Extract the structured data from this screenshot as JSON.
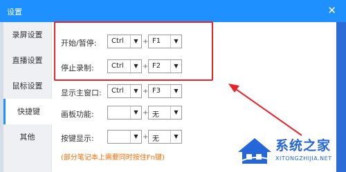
{
  "window": {
    "title": "设置",
    "close_glyph": "✕",
    "accent": "#1e90ff"
  },
  "sidebar": {
    "items": [
      {
        "label": "录屏设置",
        "active": false
      },
      {
        "label": "直播设置",
        "active": false
      },
      {
        "label": "鼠标设置",
        "active": false
      },
      {
        "label": "快捷键",
        "active": true
      },
      {
        "label": "其他",
        "active": false
      }
    ]
  },
  "shortcuts": [
    {
      "label": "开始/暂停:",
      "modifier": "Ctrl",
      "key": "F1"
    },
    {
      "label": "停止录制:",
      "modifier": "Ctrl",
      "key": "F2"
    },
    {
      "label": "显示主窗口:",
      "modifier": "Ctrl",
      "key": "F3"
    },
    {
      "label": "画板功能:",
      "modifier": "",
      "key": "无"
    },
    {
      "label": "按键显示:",
      "modifier": "",
      "key": "无"
    }
  ],
  "plus_sign": "+",
  "dropdown_arrow": "▼",
  "note": "(部分笔记本上需要同时按住Fn键)",
  "annotation": {
    "highlight_color": "#e8232a",
    "arrow_color": "#e8232a"
  },
  "watermark": {
    "name": "系统之家",
    "url": "XITONGZHIJIA.NET",
    "color": "#2566d8"
  }
}
